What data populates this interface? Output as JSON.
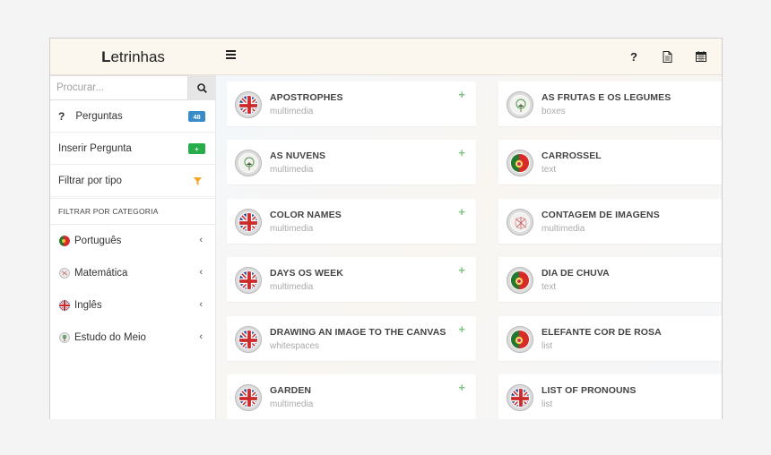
{
  "header": {
    "brand_first": "L",
    "brand_rest": "etrinhas",
    "help_label": "?"
  },
  "sidebar": {
    "search_placeholder": "Procurar...",
    "perguntas": {
      "mark": "?",
      "label": "Perguntas",
      "count": "48"
    },
    "inserir": {
      "label": "Inserir Pergunta",
      "badge": "+"
    },
    "filtrar": {
      "label": "Filtrar por tipo"
    },
    "category_heading": "FILTRAR POR CATEGORIA",
    "categories": [
      {
        "label": "Português",
        "icon": "portugal-flag-icon"
      },
      {
        "label": "Matemática",
        "icon": "math-icon"
      },
      {
        "label": "Inglês",
        "icon": "uk-flag-icon"
      },
      {
        "label": "Estudo do Meio",
        "icon": "tree-icon"
      }
    ],
    "chevron": "‹"
  },
  "cards_left": [
    {
      "title": "APOSTROPHES",
      "sub": "multimedia",
      "icon": "uk-flag-icon"
    },
    {
      "title": "AS NUVENS",
      "sub": "multimedia",
      "icon": "tree-icon"
    },
    {
      "title": "COLOR NAMES",
      "sub": "multimedia",
      "icon": "uk-flag-icon"
    },
    {
      "title": "DAYS OS WEEK",
      "sub": "multimedia",
      "icon": "uk-flag-icon"
    },
    {
      "title": "DRAWING AN IMAGE TO THE CANVAS",
      "sub": "whitespaces",
      "icon": "uk-flag-icon"
    },
    {
      "title": "GARDEN",
      "sub": "multimedia",
      "icon": "uk-flag-icon"
    }
  ],
  "cards_right": [
    {
      "title": "AS FRUTAS E OS LEGUMES",
      "sub": "boxes",
      "icon": "tree-icon"
    },
    {
      "title": "CARROSSEL",
      "sub": "text",
      "icon": "portugal-flag-icon"
    },
    {
      "title": "CONTAGEM DE IMAGENS",
      "sub": "multimedia",
      "icon": "math-icon"
    },
    {
      "title": "DIA DE CHUVA",
      "sub": "text",
      "icon": "portugal-flag-icon"
    },
    {
      "title": "ELEFANTE COR DE ROSA",
      "sub": "list",
      "icon": "portugal-flag-icon"
    },
    {
      "title": "LIST OF PRONOUNS",
      "sub": "list",
      "icon": "uk-flag-icon"
    }
  ],
  "plus_label": "+",
  "colors": {
    "accent_green": "#7bc47f",
    "badge_blue": "#3a8cc9",
    "badge_green": "#27ae4a",
    "funnel_orange": "#f5a623"
  }
}
